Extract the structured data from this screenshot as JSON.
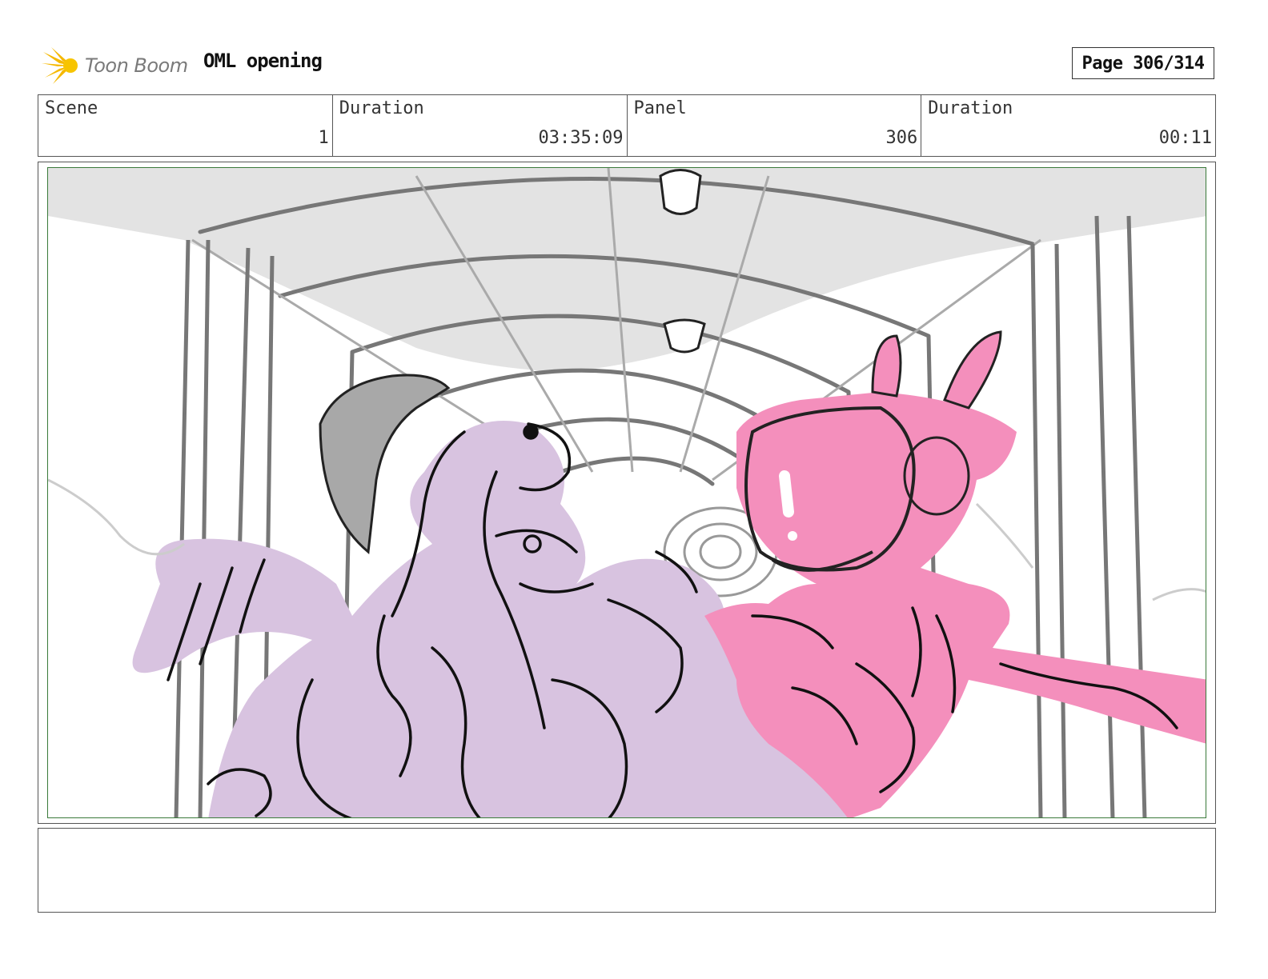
{
  "header": {
    "logo_text": "Toon Boom",
    "project_title": "OML opening",
    "page_indicator": "Page 306/314"
  },
  "info": {
    "scene_label": "Scene",
    "scene_value": "1",
    "scene_duration_label": "Duration",
    "scene_duration_value": "03:35:09",
    "panel_label": "Panel",
    "panel_value": "306",
    "panel_duration_label": "Duration",
    "panel_duration_value": "00:11"
  },
  "notes": {
    "text": ""
  },
  "colors": {
    "panel_border": "#3a7a3a",
    "purple_character": "#d8c3e0",
    "pink_robot": "#f48fbc",
    "ceiling_gray": "#e3e3e3",
    "logo_accent": "#f5b800"
  }
}
